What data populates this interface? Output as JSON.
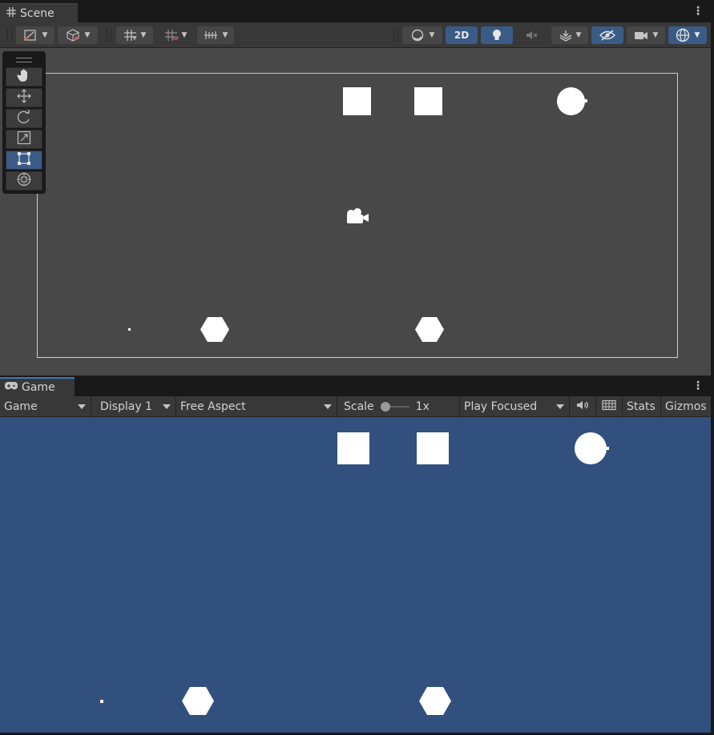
{
  "scene_panel": {
    "tab_title": "Scene",
    "toolbar": {
      "toggle_2d": "2D"
    }
  },
  "tools": [
    "hand-tool",
    "move-tool",
    "rotate-tool",
    "scale-tool",
    "rect-tool",
    "transform-tool"
  ],
  "active_tool": "rect-tool",
  "game_panel": {
    "tab_title": "Game",
    "toolbar": {
      "view_mode": "Game",
      "display": "Display 1",
      "aspect": "Free Aspect",
      "scale_label": "Scale",
      "scale_value": "1x",
      "play_mode": "Play Focused",
      "stats_label": "Stats",
      "gizmos_label": "Gizmos"
    }
  },
  "colors": {
    "scene_background": "#484848",
    "game_background": "#31507e",
    "active_button": "#3a5b85",
    "sprite": "#ffffff"
  }
}
